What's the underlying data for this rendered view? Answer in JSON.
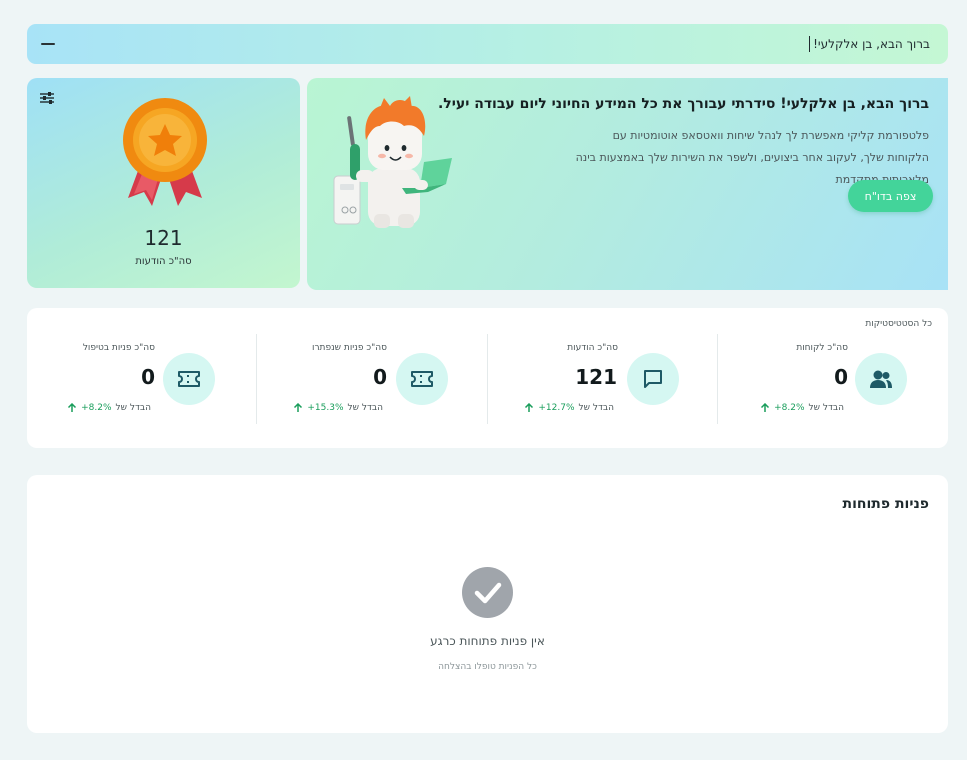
{
  "header": {
    "title": "ברוך הבא, בן אלקלעי!"
  },
  "award": {
    "value": "121",
    "label": "סה\"כ הודעות"
  },
  "welcome": {
    "title": "ברוך הבא, בן אלקלעי! סידרתי עבורך את כל המידע החיוני ליום עבודה יעיל.",
    "description": "פלטפורמת קליקי מאפשרת לך לנהל שיחות וואטסאפ אוטומטיות עם הלקוחות שלך, לעקוב אחר ביצועים, ולשפר את השירות שלך באמצעות בינה מלאכותית מתקדמת",
    "button_label": "צפה בדו\"ח"
  },
  "stats": {
    "heading": "כל הסטטיסטיקות",
    "items": [
      {
        "label": "סה\"כ לקוחות",
        "value": "0",
        "change_prefix": "הבדל של",
        "change_pct": "+8.2%",
        "icon": "users-icon"
      },
      {
        "label": "סה\"כ הודעות",
        "value": "121",
        "change_prefix": "הבדל של",
        "change_pct": "+12.7%",
        "icon": "message-icon"
      },
      {
        "label": "סה\"כ פניות שנפתרו",
        "value": "0",
        "change_prefix": "הבדל של",
        "change_pct": "+15.3%",
        "icon": "ticket-icon"
      },
      {
        "label": "סה\"כ פניות בטיפול",
        "value": "0",
        "change_prefix": "הבדל של",
        "change_pct": "+8.2%",
        "icon": "ticket-icon"
      }
    ]
  },
  "tickets": {
    "title": "פניות פתוחות",
    "empty_title": "אין פניות פתוחות כרגע",
    "empty_subtitle": "כל הפניות טופלו בהצלחה"
  },
  "colors": {
    "accent": "#43d49a",
    "positive": "#1a9e5c",
    "icon_bg": "#d5f7f2",
    "icon_fg": "#1e5a66"
  }
}
